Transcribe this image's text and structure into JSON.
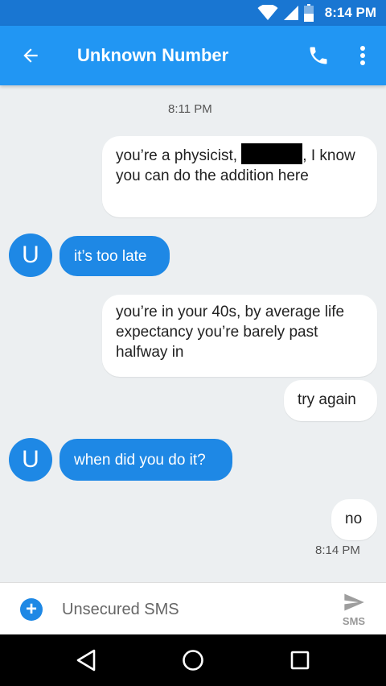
{
  "status_bar": {
    "time": "8:14 PM"
  },
  "app_bar": {
    "title": "Unknown Number"
  },
  "conversation": {
    "timestamp_top": "8:11 PM",
    "avatar_letter": "U",
    "msg1": {
      "before": "you’re a physicist, ",
      "after": ", I know you can do the addition here"
    },
    "msg2": "it’s too late",
    "msg3": "you’re in your 40s, by average life expectancy you’re barely past halfway in",
    "msg4": "try again",
    "msg5": "when did you do it?",
    "msg6": "no",
    "timestamp_bottom": "8:14 PM"
  },
  "composer": {
    "placeholder": "Unsecured SMS",
    "send_label": "SMS"
  },
  "colors": {
    "status": "#1976D2",
    "appbar": "#2196F3",
    "incoming": "#1E88E5",
    "background": "#ECEFF1"
  }
}
